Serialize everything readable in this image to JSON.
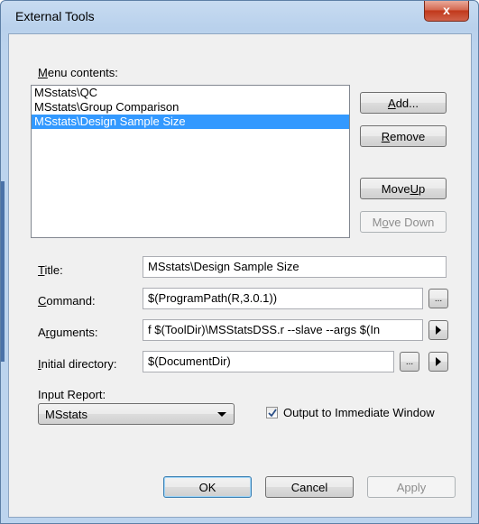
{
  "window": {
    "title": "External Tools",
    "close_glyph": "x"
  },
  "menu_contents": {
    "label_pre": "",
    "label_accel": "M",
    "label_post": "enu contents:",
    "items": [
      {
        "text": "MSstats\\QC",
        "selected": false
      },
      {
        "text": "MSstats\\Group Comparison",
        "selected": false
      },
      {
        "text": "MSstats\\Design Sample Size",
        "selected": true
      }
    ]
  },
  "buttons": {
    "add": {
      "pre": "",
      "accel": "A",
      "post": "dd..."
    },
    "remove": {
      "pre": "",
      "accel": "R",
      "post": "emove"
    },
    "move_up": {
      "pre": "Move ",
      "accel": "U",
      "post": "p"
    },
    "move_down": {
      "pre": "M",
      "accel": "o",
      "post": "ve Down"
    },
    "ok": "OK",
    "cancel": "Cancel",
    "apply": "Apply",
    "browse_glyph": "...",
    "macro_arrow_icon": "play-triangle-icon"
  },
  "fields": {
    "title": {
      "label_accel": "T",
      "label_post": "itle:",
      "value": "MSstats\\Design Sample Size"
    },
    "command": {
      "label_accel": "C",
      "label_post": "ommand:",
      "value": "$(ProgramPath(R,3.0.1))"
    },
    "arguments": {
      "label_pre": "A",
      "label_accel": "r",
      "label_post": "guments:",
      "value": "f $(ToolDir)\\MSStatsDSS.r --slave --args $(In"
    },
    "initial_directory": {
      "label_accel": "I",
      "label_post": "nitial directory:",
      "value": "$(DocumentDir)"
    }
  },
  "input_report": {
    "label": "Input Report:",
    "selected": "MSstats"
  },
  "output_immediate": {
    "label": "Output to Immediate Window",
    "checked": true
  },
  "colors": {
    "selection": "#3399ff",
    "close": "#c1391b",
    "frame": "#b9d1ec"
  }
}
